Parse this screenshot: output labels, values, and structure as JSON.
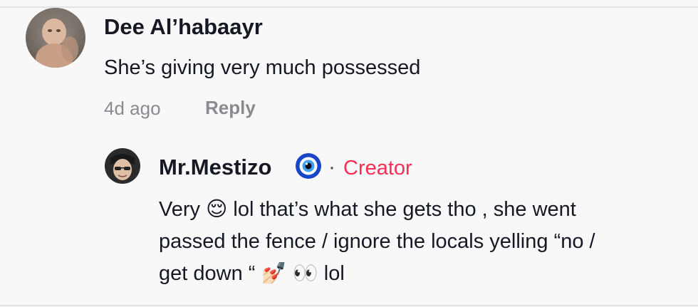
{
  "comment": {
    "username": "Dee Al’habaayr",
    "text": "She’s giving very much possessed",
    "timestamp": "4d ago",
    "reply_label": "Reply",
    "avatar_icon": "user-avatar-photo"
  },
  "reply": {
    "username": "Mr.Mestizo",
    "badge_icon": "nazar-eye-emoji",
    "separator": "·",
    "creator_label": "Creator",
    "text_lines": [
      "Very 😌 lol that’s what she gets tho , she went",
      "passed the fence / ignore the locals yelling “no /",
      "get down “ 💅🏻 👀 lol"
    ],
    "avatar_icon": "user-avatar-photo"
  },
  "colors": {
    "background": "#f8f8f8",
    "text_primary": "#161823",
    "text_secondary": "#8a8b91",
    "creator_accent": "#fe2c55",
    "divider": "#e3e3e4"
  }
}
